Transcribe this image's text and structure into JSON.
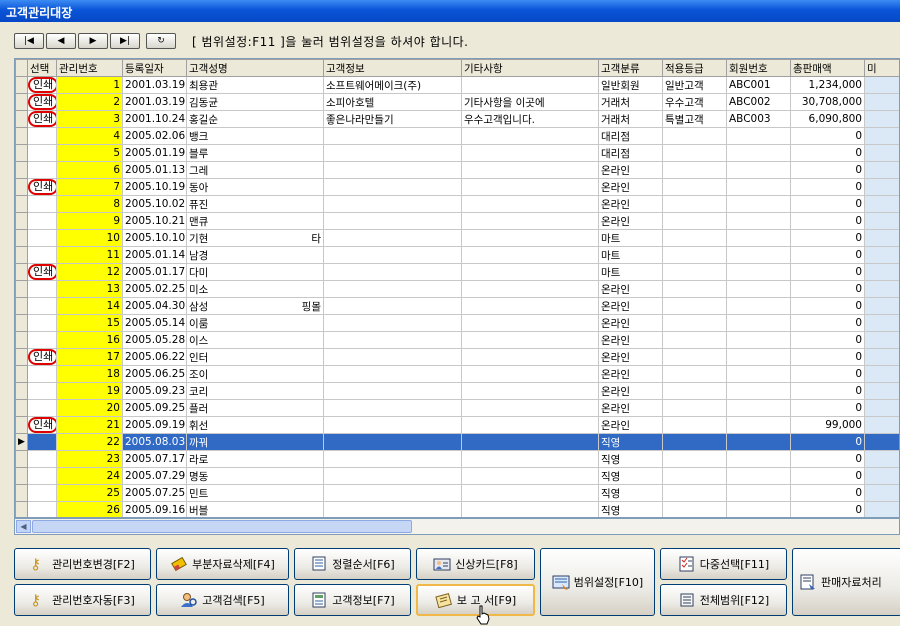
{
  "window": {
    "title": "고객관리대장"
  },
  "nav": {
    "buttons": [
      "|◀",
      "◀",
      "▶",
      "▶|",
      "↻"
    ],
    "hint": "[ 범위설정:F11 ]을 눌러 범위설정을 하셔야 합니다."
  },
  "grid": {
    "columns": [
      "선택",
      "관리번호",
      "등록일자",
      "고객성명",
      "고객정보",
      "기타사항",
      "고객분류",
      "적용등급",
      "회원번호",
      "총판매액",
      "미"
    ],
    "rows": [
      {
        "sel": "인쇄",
        "no": "1",
        "date": "2001.03.19",
        "name": "최용관",
        "info": "소프트웨어메이크(주)",
        "etc": "",
        "cls": "일반회원",
        "grade": "일반고객",
        "mem": "ABC001",
        "total": "1,234,000"
      },
      {
        "sel": "인쇄",
        "no": "2",
        "date": "2001.03.19",
        "name": "김동균",
        "info": "소피아호텔",
        "etc": "기타사항을 이곳에",
        "cls": "거래처",
        "grade": "우수고객",
        "mem": "ABC002",
        "total": "30,708,000"
      },
      {
        "sel": "인쇄",
        "no": "3",
        "date": "2001.10.24",
        "name": "홍길순",
        "info": "좋은나라만들기",
        "etc": "우수고객입니다.",
        "cls": "거래처",
        "grade": "특별고객",
        "mem": "ABC003",
        "total": "6,090,800"
      },
      {
        "sel": "",
        "no": "4",
        "date": "2005.02.06",
        "name": "뱅크",
        "info": "",
        "etc": "",
        "cls": "대리점",
        "grade": "",
        "mem": "",
        "total": "0"
      },
      {
        "sel": "",
        "no": "5",
        "date": "2005.01.19",
        "name": "블루",
        "info": "",
        "etc": "",
        "cls": "대리점",
        "grade": "",
        "mem": "",
        "total": "0"
      },
      {
        "sel": "",
        "no": "6",
        "date": "2005.01.13",
        "name": "그레",
        "info": "",
        "etc": "",
        "cls": "온라인",
        "grade": "",
        "mem": "",
        "total": "0"
      },
      {
        "sel": "인쇄",
        "no": "7",
        "date": "2005.10.19",
        "name": "동아",
        "info": "",
        "etc": "",
        "cls": "온라인",
        "grade": "",
        "mem": "",
        "total": "0"
      },
      {
        "sel": "",
        "no": "8",
        "date": "2005.10.02",
        "name": "퓨진",
        "info": "",
        "etc": "",
        "cls": "온라인",
        "grade": "",
        "mem": "",
        "total": "0"
      },
      {
        "sel": "",
        "no": "9",
        "date": "2005.10.21",
        "name": "맨큐",
        "info": "",
        "etc": "",
        "cls": "온라인",
        "grade": "",
        "mem": "",
        "total": "0"
      },
      {
        "sel": "",
        "no": "10",
        "date": "2005.10.10",
        "name": "기현",
        "name2": "타",
        "info": "",
        "etc": "",
        "cls": "마트",
        "grade": "",
        "mem": "",
        "total": "0"
      },
      {
        "sel": "",
        "no": "11",
        "date": "2005.01.14",
        "name": "남경",
        "info": "",
        "etc": "",
        "cls": "마트",
        "grade": "",
        "mem": "",
        "total": "0"
      },
      {
        "sel": "인쇄",
        "no": "12",
        "date": "2005.01.17",
        "name": "다미",
        "info": "",
        "etc": "",
        "cls": "마트",
        "grade": "",
        "mem": "",
        "total": "0"
      },
      {
        "sel": "",
        "no": "13",
        "date": "2005.02.25",
        "name": "미소",
        "info": "",
        "etc": "",
        "cls": "온라인",
        "grade": "",
        "mem": "",
        "total": "0"
      },
      {
        "sel": "",
        "no": "14",
        "date": "2005.04.30",
        "name": "삼성",
        "name2": "핑몰",
        "info": "",
        "etc": "",
        "cls": "온라인",
        "grade": "",
        "mem": "",
        "total": "0"
      },
      {
        "sel": "",
        "no": "15",
        "date": "2005.05.14",
        "name": "이룸",
        "info": "",
        "etc": "",
        "cls": "온라인",
        "grade": "",
        "mem": "",
        "total": "0"
      },
      {
        "sel": "",
        "no": "16",
        "date": "2005.05.28",
        "name": "이스",
        "info": "",
        "etc": "",
        "cls": "온라인",
        "grade": "",
        "mem": "",
        "total": "0"
      },
      {
        "sel": "인쇄",
        "no": "17",
        "date": "2005.06.22",
        "name": "인터",
        "info": "",
        "etc": "",
        "cls": "온라인",
        "grade": "",
        "mem": "",
        "total": "0"
      },
      {
        "sel": "",
        "no": "18",
        "date": "2005.06.25",
        "name": "조이",
        "info": "",
        "etc": "",
        "cls": "온라인",
        "grade": "",
        "mem": "",
        "total": "0"
      },
      {
        "sel": "",
        "no": "19",
        "date": "2005.09.23",
        "name": "코리",
        "info": "",
        "etc": "",
        "cls": "온라인",
        "grade": "",
        "mem": "",
        "total": "0"
      },
      {
        "sel": "",
        "no": "20",
        "date": "2005.09.25",
        "name": "플러",
        "info": "",
        "etc": "",
        "cls": "온라인",
        "grade": "",
        "mem": "",
        "total": "0"
      },
      {
        "sel": "인쇄",
        "no": "21",
        "date": "2005.09.19",
        "name": "휘선",
        "info": "",
        "etc": "",
        "cls": "온라인",
        "grade": "",
        "mem": "",
        "total": "99,000"
      },
      {
        "sel": "",
        "no": "22",
        "date": "2005.08.03",
        "name": "까꿔",
        "info": "",
        "etc": "",
        "cls": "직영",
        "grade": "",
        "mem": "",
        "total": "0",
        "current": true
      },
      {
        "sel": "",
        "no": "23",
        "date": "2005.07.17",
        "name": "라로",
        "info": "",
        "etc": "",
        "cls": "직영",
        "grade": "",
        "mem": "",
        "total": "0"
      },
      {
        "sel": "",
        "no": "24",
        "date": "2005.07.29",
        "name": "명동",
        "info": "",
        "etc": "",
        "cls": "직영",
        "grade": "",
        "mem": "",
        "total": "0"
      },
      {
        "sel": "",
        "no": "25",
        "date": "2005.07.25",
        "name": "민트",
        "info": "",
        "etc": "",
        "cls": "직영",
        "grade": "",
        "mem": "",
        "total": "0"
      },
      {
        "sel": "",
        "no": "26",
        "date": "2005.09.16",
        "name": "버블",
        "info": "",
        "etc": "",
        "cls": "직영",
        "grade": "",
        "mem": "",
        "total": "0"
      }
    ]
  },
  "buttons": {
    "change_no": "관리번호변경[F2]",
    "auto_no": "관리번호자동[F3]",
    "partial_delete": "부분자료삭제[F4]",
    "customer_search": "고객검색[F5]",
    "sort_order": "정렬순서[F6]",
    "customer_info": "고객정보[F7]",
    "credit_card": "신상카드[F8]",
    "report": "보 고 서[F9]",
    "range_setting": "범위설정[F10]",
    "multi_select": "다중선택[F11]",
    "full_range": "전체범위[F12]",
    "sales_data": "판매자료처리"
  },
  "icons": {
    "change_no": "key-icon",
    "auto_no": "key-icon",
    "partial_delete": "eraser-icon",
    "customer_search": "person-search-icon",
    "sort_order": "sort-icon",
    "customer_info": "document-icon",
    "credit_card": "person-card-icon",
    "report": "report-icon",
    "range_setting": "range-icon",
    "multi_select": "checklist-icon",
    "full_range": "scroll-icon",
    "sales_data": "sales-doc-icon"
  },
  "colors": {
    "title": "#0a55d8",
    "selected_row": "#316ac5",
    "number_cell": "#ffff00",
    "print_marker": "#e00000"
  }
}
